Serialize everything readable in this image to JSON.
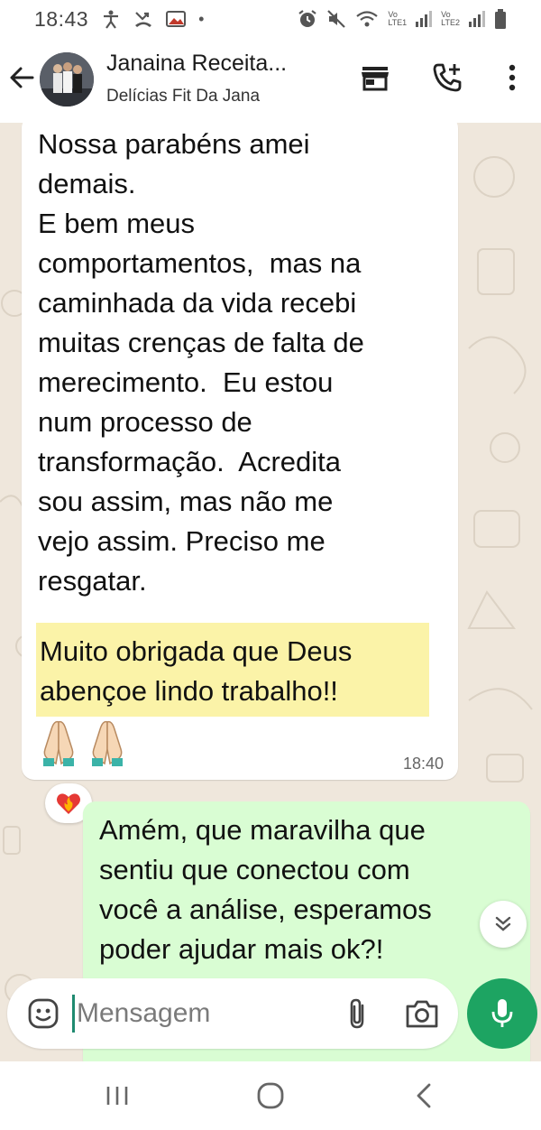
{
  "status_bar": {
    "time": "18:43",
    "sim1": "LTE1",
    "sim2": "LTE2",
    "vo": "Vo"
  },
  "header": {
    "contact_name": "Janaina Receita...",
    "subtitle": "Delícias Fit Da Jana",
    "icons": [
      "back-arrow-icon",
      "store-icon",
      "add-call-icon",
      "more-vert-icon"
    ]
  },
  "chat": {
    "incoming_message": {
      "text": "Nossa parabéns amei\ndemais.\nE bem meus\ncomportamentos,  mas na\ncaminhada da vida recebi\nmuitas crenças de falta de\nmerecimento.  Eu estou\nnum processo de\ntransformação.  Acredita\nsou assim, mas não me\nvejo assim. Preciso me\nresgatar.",
      "highlighted_text": "Muito obrigada que Deus\nabençoe lindo trabalho!!",
      "emoji": "🙏🏻🙏🏻",
      "time": "18:40"
    },
    "reaction": "❤️‍🔥",
    "outgoing_message": {
      "text": "Amém, que maravilha que\nsentiu que conectou com\nvocê a análise, esperamos\npoder ajudar mais ok?!"
    }
  },
  "composer": {
    "placeholder": "Mensagem",
    "value": ""
  },
  "colors": {
    "chat_background": "#efe7dc",
    "outgoing_bubble": "#d9fdd3",
    "highlight": "#fbf3a8",
    "mic_button": "#1da462"
  }
}
